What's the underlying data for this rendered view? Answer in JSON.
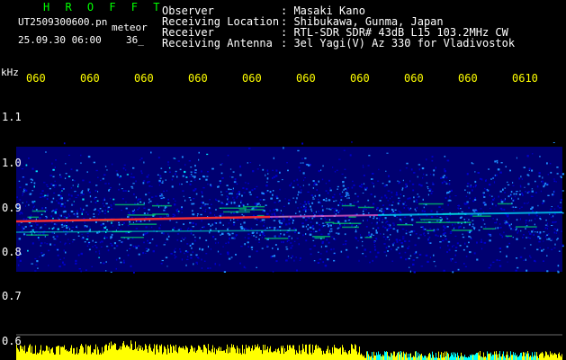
{
  "header": {
    "app_title": "H R O F F T",
    "filename": "UT2509300600.pn",
    "mode_label": "meteor",
    "datetime": "25.09.30 06:00",
    "count": "36_",
    "info": [
      {
        "label": "Observer",
        "value": ": Masaki Kano"
      },
      {
        "label": "Receiving Location",
        "value": ": Shibukawa, Gunma, Japan"
      },
      {
        "label": "Receiver",
        "value": ": RTL-SDR SDR# 43dB L15 103.2MHz CW"
      },
      {
        "label": "Receiving Antenna",
        "value": ": 3el Yagi(V) Az 330 for Vladivostok"
      }
    ]
  },
  "axis": {
    "unit": "kHz",
    "time_ticks": [
      "060",
      "060",
      "060",
      "060",
      "060",
      "060",
      "060",
      "060",
      "060",
      "0610"
    ],
    "freq_ticks": [
      "1.1",
      "1.0",
      "0.9",
      "0.8",
      "0.7",
      "0.6"
    ]
  },
  "colors": {
    "background": "#000000",
    "title": "#00ff00",
    "text": "#ffffff",
    "axis_text": "#ffff00",
    "noise_low": "#0000cc",
    "noise_mid": "#1e90ff",
    "noise_high": "#00e5ff",
    "signal": "#ff3030",
    "echo": "#00ff66",
    "baseline_bars": "#ffff00",
    "baseline_low": "#00ffff"
  }
}
